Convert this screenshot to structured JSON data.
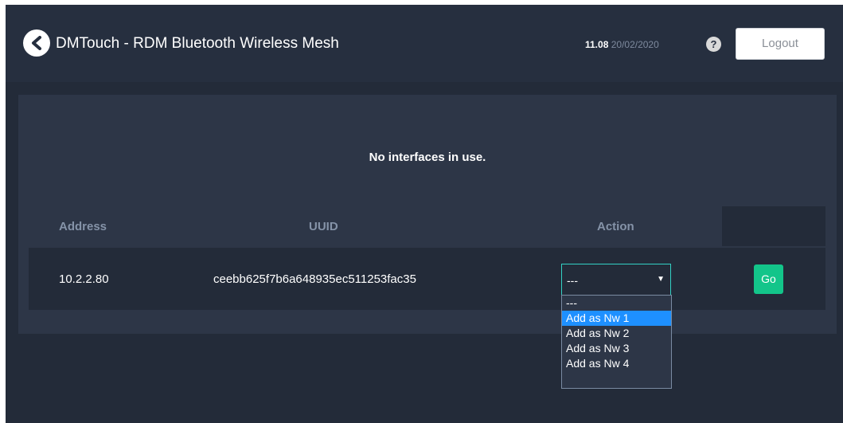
{
  "header": {
    "title": "DMTouch - RDM Bluetooth Wireless Mesh",
    "time": "11.08",
    "date": "20/02/2020",
    "help_symbol": "?",
    "logout_label": "Logout",
    "back_icon": "chevron-left-icon",
    "help_icon": "question-circle-icon"
  },
  "panel": {
    "message": "No interfaces in use.",
    "columns": [
      "Address",
      "UUID",
      "Action"
    ],
    "rows": [
      {
        "address": "10.2.2.80",
        "uuid": "ceebb625f7b6a648935ec511253fac35",
        "action_value": "---",
        "go_label": "Go"
      }
    ]
  },
  "dropdown": {
    "options": [
      "---",
      "Add as Nw 1",
      "Add as Nw 2",
      "Add as Nw 3",
      "Add as Nw 4"
    ],
    "highlighted": "Add as Nw 1"
  },
  "colors": {
    "background": "#232b39",
    "panel": "#2d3647",
    "go_button": "#13c58a",
    "select_border": "#33d1c4",
    "option_highlight": "#1e90ff"
  }
}
